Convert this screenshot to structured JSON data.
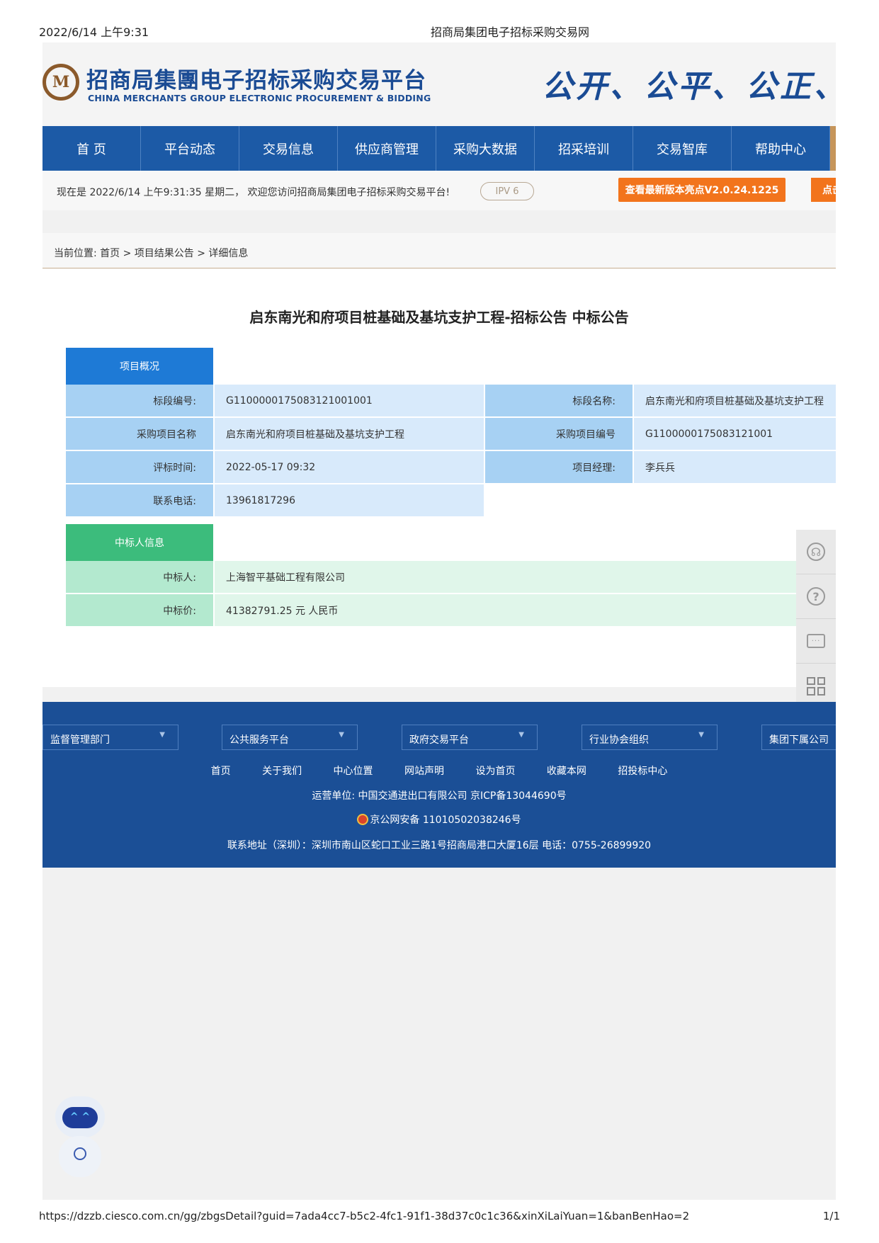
{
  "print_header": {
    "date": "2022/6/14 上午9:31",
    "title": "招商局集团电子招标采购交易网"
  },
  "print_footer": {
    "url": "https://dzzb.ciesco.com.cn/gg/zbgsDetail?guid=7ada4cc7-b5c2-4fc1-91f1-38d37c0c1c36&xinXiLaiYuan=1&banBenHao=2",
    "page": "1/1"
  },
  "brand": {
    "name_cn": "招商局集團电子招标采购交易平台",
    "name_en": "CHINA MERCHANTS GROUP ELECTRONIC PROCUREMENT & BIDDING",
    "slogan": "公开、公平、公正、诚",
    "color": "#1a4b94"
  },
  "nav": [
    "首 页",
    "平台动态",
    "交易信息",
    "供应商管理",
    "采购大数据",
    "招采培训",
    "交易智库",
    "帮助中心"
  ],
  "welcome": {
    "message": "现在是 2022/6/14 上午9:31:35 星期二， 欢迎您访问招商局集团电子招标采购交易平台!",
    "ipv6": "IPV 6",
    "new_version": "查看最新版本亮点V2.0.24.1225",
    "click": "点击"
  },
  "breadcrumb": "当前位置:   首页 > 项目结果公告 > 详细信息",
  "doc_title": "启东南光和府项目桩基础及基坑支护工程-招标公告 中标公告",
  "overview": {
    "heading": "项目概况",
    "rows": [
      {
        "l1": "标段编号:",
        "v1": "G1100000175083121001001",
        "l2": "标段名称:",
        "v2": "启东南光和府项目桩基础及基坑支护工程"
      },
      {
        "l1": "采购项目名称",
        "v1": "启东南光和府项目桩基础及基坑支护工程",
        "l2": "采购项目编号",
        "v2": "G1100000175083121001"
      },
      {
        "l1": "评标时间:",
        "v1": "2022-05-17 09:32",
        "l2": "项目经理:",
        "v2": "李兵兵"
      },
      {
        "l1": "联系电话:",
        "v1": "13961817296"
      }
    ]
  },
  "winner": {
    "heading": "中标人信息",
    "rows": [
      {
        "label": "中标人:",
        "value": "上海智平基础工程有限公司"
      },
      {
        "label": "中标价:",
        "value": "41382791.25 元 人民币"
      }
    ]
  },
  "side_tools": [
    "headset-icon",
    "help-icon",
    "chat-icon",
    "qrcode-icon"
  ],
  "footer": {
    "dropdowns": [
      "监督管理部门",
      "公共服务平台",
      "政府交易平台",
      "行业协会组织",
      "集团下属公司"
    ],
    "links": [
      "首页",
      "关于我们",
      "中心位置",
      "网站声明",
      "设为首页",
      "收藏本网",
      "招投标中心"
    ],
    "operator": "运营单位: 中国交通进出口有限公司    京ICP备13044690号",
    "police": "京公网安备 11010502038246号",
    "address": "联系地址（深圳）：深圳市南山区蛇口工业三路1号招商局港口大厦16层  电话：0755-26899920"
  }
}
